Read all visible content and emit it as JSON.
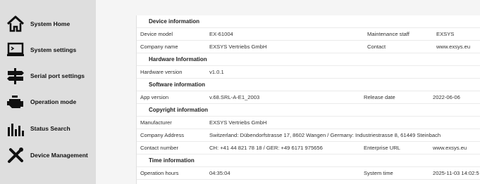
{
  "sidebar": {
    "items": [
      {
        "label": "System Home",
        "icon": "home-icon"
      },
      {
        "label": "System settings",
        "icon": "laptop-icon"
      },
      {
        "label": "Serial port settings",
        "icon": "signpost-icon"
      },
      {
        "label": "Operation mode",
        "icon": "engine-icon"
      },
      {
        "label": "Status Search",
        "icon": "bar-chart-icon"
      },
      {
        "label": "Device Management",
        "icon": "tools-icon"
      }
    ]
  },
  "info": {
    "device_header": "Device information",
    "device_model_label": "Device model",
    "device_model_value": "EX-61004",
    "maintenance_label": "Maintenance staff",
    "maintenance_value": "EXSYS",
    "company_label": "Company name",
    "company_value": "EXSYS Vertriebs GmbH",
    "contact_label": "Contact",
    "contact_value": "www.exsys.eu",
    "hardware_header": "Hardware Information",
    "hardware_version_label": "Hardware version",
    "hardware_version_value": "v1.0.1",
    "software_header": "Software information",
    "app_version_label": "App version",
    "app_version_value": "v.68.SRL-A-E1_2003",
    "release_label": "Release date",
    "release_value": "2022-06-06",
    "copyright_header": "Copyright information",
    "manufacturer_label": "Manufacturer",
    "manufacturer_value": "EXSYS Vertriebs GmbH",
    "address_label": "Company Address",
    "address_value": "Switzerland: Dübendorfstrasse 17, 8602 Wangen / Germany: Industriestrasse 8, 61449 Steinbach",
    "contact_number_label": "Contact number",
    "contact_number_value": "CH: +41 44 821 78 18 / GER: +49 6171 975656",
    "enterprise_url_label": "Enterprise URL",
    "enterprise_url_value": "www.exsys.eu",
    "time_header": "Time information",
    "operation_hours_label": "Operation hours",
    "operation_hours_value": "04:35:04",
    "system_time_label": "System time",
    "system_time_value": "2025-11-03 14:02:5"
  }
}
